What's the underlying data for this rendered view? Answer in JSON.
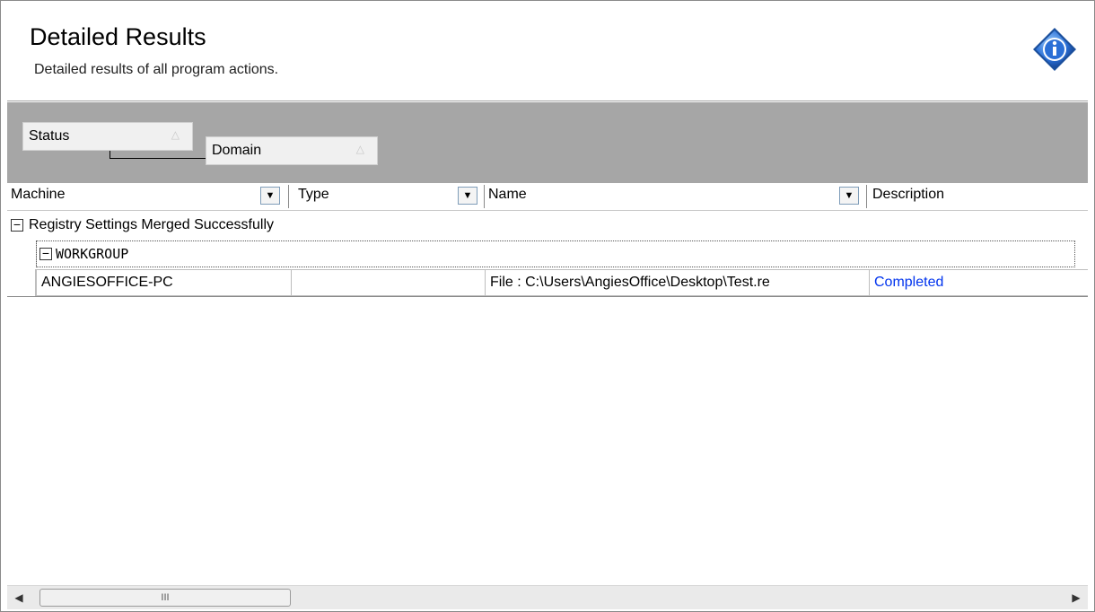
{
  "header": {
    "title": "Detailed Results",
    "subtitle": "Detailed results of all program actions.",
    "icon": "info-icon"
  },
  "group_by": {
    "items": [
      {
        "label": "Status",
        "sort_glyph": "△"
      },
      {
        "label": "Domain",
        "sort_glyph": "△"
      }
    ]
  },
  "columns": [
    {
      "label": "Machine",
      "dropdown_glyph": "▼"
    },
    {
      "label": "Type",
      "dropdown_glyph": "▼"
    },
    {
      "label": "Name",
      "dropdown_glyph": "▼"
    },
    {
      "label": "Description"
    }
  ],
  "groups": [
    {
      "label": "Registry Settings Merged Successfully",
      "expander": "−",
      "subgroup": {
        "label": "WORKGROUP",
        "expander": "−",
        "rows": [
          {
            "machine": "ANGIESOFFICE-PC",
            "type": "",
            "name": "File : C:\\Users\\AngiesOffice\\Desktop\\Test.re",
            "description": "Completed"
          }
        ]
      }
    }
  ],
  "scrollbar": {
    "left_arrow": "◀",
    "right_arrow": "▶",
    "grip": "III"
  },
  "colors": {
    "group_band": "#a6a6a6",
    "link": "#0033ee",
    "info_icon": "#2a6fd6"
  }
}
